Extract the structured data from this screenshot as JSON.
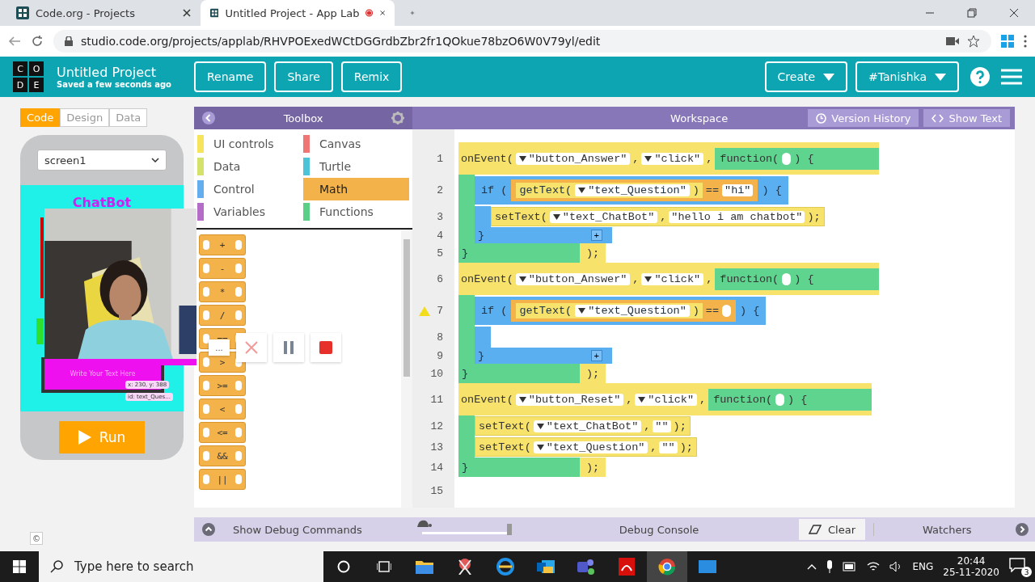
{
  "browser": {
    "tabs": [
      {
        "title": "Code.org - Projects",
        "selected": false,
        "recording": false
      },
      {
        "title": "Untitled Project - App Lab",
        "selected": true,
        "recording": true
      }
    ],
    "url": "studio.code.org/projects/applab/RHVPOExedWCtDGGrdbZbr2fr1QOkue78bzO6W0V79yl/edit"
  },
  "header": {
    "logo": [
      "C",
      "O",
      "D",
      "E"
    ],
    "title": "Untitled Project",
    "status": "Saved a few seconds ago",
    "actions": [
      "Rename",
      "Share",
      "Remix"
    ],
    "menus": [
      "Create",
      "#Tanishka"
    ]
  },
  "mode_tabs": [
    {
      "label": "Code",
      "selected": true
    },
    {
      "label": "Design",
      "selected": false
    },
    {
      "label": "Data",
      "selected": false
    }
  ],
  "preview": {
    "screen": "screen1",
    "title": "ChatBot",
    "input_placeholder": "Write Your Text Here",
    "tooltips": [
      "x: 230, y: 388",
      "id: text_Ques..."
    ],
    "run": "Run"
  },
  "footer_mark": "©",
  "recorder": {
    "more": "..."
  },
  "toolbox": {
    "title": "Toolbox",
    "categories": [
      {
        "label": "UI controls",
        "color": "#f6e45c",
        "selected": false
      },
      {
        "label": "Canvas",
        "color": "#f07575",
        "selected": false
      },
      {
        "label": "Data",
        "color": "#d2e26a",
        "selected": false
      },
      {
        "label": "Turtle",
        "color": "#4cc3d6",
        "selected": false
      },
      {
        "label": "Control",
        "color": "#64aef0",
        "selected": false
      },
      {
        "label": "Math",
        "color": "#f4b24a",
        "selected": true
      },
      {
        "label": "Variables",
        "color": "#b56cc8",
        "selected": false
      },
      {
        "label": "Functions",
        "color": "#5ccf86",
        "selected": false
      }
    ],
    "blocks": [
      "+",
      "-",
      "*",
      "/",
      "==",
      ">",
      ">=",
      "<",
      "<=",
      "&&",
      "||"
    ]
  },
  "workspace": {
    "title": "Workspace",
    "buttons": [
      "Version History",
      "Show Text"
    ],
    "code": [
      {
        "kind": "event",
        "number": "1",
        "tokens": [
          {
            "kind": "word",
            "text": "onEvent("
          },
          {
            "kind": "dropdown",
            "text": "\"button_Answer\""
          },
          {
            "kind": "word",
            "text": ","
          },
          {
            "kind": "dropdown",
            "text": "\"click\""
          },
          {
            "kind": "word",
            "text": ","
          },
          {
            "kind": "function",
            "tokens": [
              {
                "kind": "word",
                "text": "function("
              },
              {
                "kind": "slot"
              },
              {
                "kind": "word",
                "text": ") {"
              }
            ]
          }
        ],
        "body": [
          {
            "kind": "if",
            "number": "2",
            "warning": false,
            "tokens": [
              {
                "kind": "word",
                "text": "if ("
              },
              {
                "kind": "compare",
                "tokens": [
                  {
                    "kind": "getter",
                    "tokens": [
                      {
                        "kind": "word",
                        "text": "getText("
                      },
                      {
                        "kind": "dropdown",
                        "text": "\"text_Question\""
                      },
                      {
                        "kind": "word",
                        "text": ")"
                      }
                    ]
                  },
                  {
                    "kind": "word",
                    "text": "=="
                  },
                  {
                    "kind": "string",
                    "text": "\"hi\""
                  }
                ]
              },
              {
                "kind": "word",
                "text": ") {"
              }
            ],
            "body": [
              {
                "kind": "call",
                "number": "3",
                "tokens": [
                  {
                    "kind": "word",
                    "text": "setText("
                  },
                  {
                    "kind": "dropdown",
                    "text": "\"text_ChatBot\""
                  },
                  {
                    "kind": "word",
                    "text": ","
                  },
                  {
                    "kind": "string",
                    "text": "\"hello i am chatbot\""
                  },
                  {
                    "kind": "word",
                    "text": ");"
                  }
                ]
              }
            ],
            "end": {
              "number": "4",
              "brace": "}",
              "plus": "+"
            }
          }
        ],
        "end": {
          "number": "5",
          "brace": "}",
          "tail": ");"
        }
      },
      {
        "kind": "event",
        "number": "6",
        "tokens": [
          {
            "kind": "word",
            "text": "onEvent("
          },
          {
            "kind": "dropdown",
            "text": "\"button_Answer\""
          },
          {
            "kind": "word",
            "text": ","
          },
          {
            "kind": "dropdown",
            "text": "\"click\""
          },
          {
            "kind": "word",
            "text": ","
          },
          {
            "kind": "function",
            "tokens": [
              {
                "kind": "word",
                "text": "function("
              },
              {
                "kind": "slot"
              },
              {
                "kind": "word",
                "text": ") {"
              }
            ]
          }
        ],
        "body": [
          {
            "kind": "if",
            "number": "7",
            "warning": true,
            "tokens": [
              {
                "kind": "word",
                "text": "if ("
              },
              {
                "kind": "compare",
                "tokens": [
                  {
                    "kind": "getter",
                    "tokens": [
                      {
                        "kind": "word",
                        "text": "getText("
                      },
                      {
                        "kind": "dropdown",
                        "text": "\"text_Question\""
                      },
                      {
                        "kind": "word",
                        "text": ")"
                      }
                    ]
                  },
                  {
                    "kind": "word",
                    "text": "=="
                  },
                  {
                    "kind": "slot"
                  }
                ]
              },
              {
                "kind": "word",
                "text": ") {"
              }
            ],
            "body": [
              {
                "kind": "empty",
                "number": "8"
              }
            ],
            "end": {
              "number": "9",
              "brace": "}",
              "plus": "+"
            }
          }
        ],
        "end": {
          "number": "10",
          "brace": "}",
          "tail": ");"
        }
      },
      {
        "kind": "event",
        "number": "11",
        "tokens": [
          {
            "kind": "word",
            "text": "onEvent("
          },
          {
            "kind": "dropdown",
            "text": "\"button_Reset\""
          },
          {
            "kind": "word",
            "text": ","
          },
          {
            "kind": "dropdown",
            "text": "\"click\""
          },
          {
            "kind": "word",
            "text": ","
          },
          {
            "kind": "function",
            "tokens": [
              {
                "kind": "word",
                "text": "function("
              },
              {
                "kind": "slot"
              },
              {
                "kind": "word",
                "text": ") {"
              }
            ]
          }
        ],
        "body": [
          {
            "kind": "call",
            "number": "12",
            "tokens": [
              {
                "kind": "word",
                "text": "setText("
              },
              {
                "kind": "dropdown",
                "text": "\"text_ChatBot\""
              },
              {
                "kind": "word",
                "text": ","
              },
              {
                "kind": "string",
                "text": "\"\""
              },
              {
                "kind": "word",
                "text": ");"
              }
            ]
          },
          {
            "kind": "call",
            "number": "13",
            "tokens": [
              {
                "kind": "word",
                "text": "setText("
              },
              {
                "kind": "dropdown",
                "text": "\"text_Question\""
              },
              {
                "kind": "word",
                "text": ","
              },
              {
                "kind": "string",
                "text": "\"\""
              },
              {
                "kind": "word",
                "text": ");"
              }
            ]
          }
        ],
        "end": {
          "number": "14",
          "brace": "}",
          "tail": ");"
        }
      },
      {
        "kind": "blank",
        "number": "15"
      }
    ]
  },
  "debug": {
    "commands": "Show Debug Commands",
    "speed": {
      "level": 0.95
    },
    "console": "Debug Console",
    "clear": "Clear",
    "watchers": "Watchers"
  },
  "taskbar": {
    "search_placeholder": "Type here to search",
    "language": "ENG",
    "time": "20:44",
    "date": "25-11-2020",
    "notifications": "3"
  }
}
